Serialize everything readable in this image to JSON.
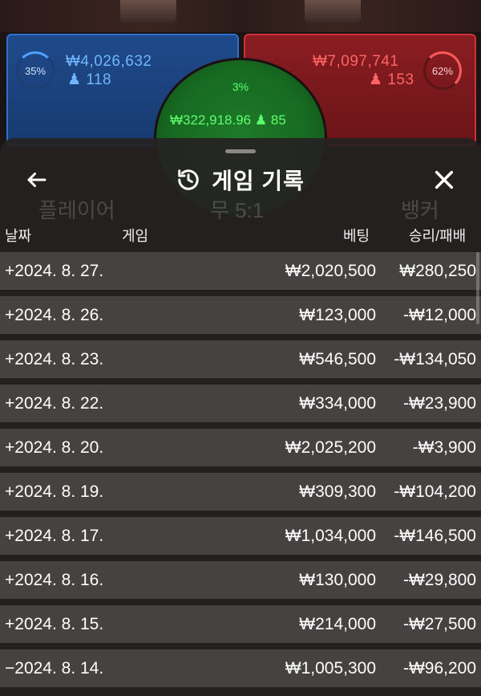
{
  "background": {
    "player": {
      "percent": "35%",
      "amount": "₩4,026,632",
      "players": "118"
    },
    "banker": {
      "percent": "62%",
      "amount": "₩7,097,741",
      "players": "153"
    },
    "tie": {
      "percent": "3%",
      "amount": "₩322,918.96",
      "players": "85"
    },
    "ghost_labels": {
      "player": "플레이어",
      "tie": "무 5:1",
      "banker": "뱅커"
    }
  },
  "header": {
    "title": "게임 기록",
    "back_icon": "arrow-left-icon",
    "history_icon": "history-icon",
    "close_icon": "close-icon"
  },
  "columns": {
    "date": "날짜",
    "game": "게임",
    "bet": "베팅",
    "result": "승리/패배"
  },
  "rows": [
    {
      "date": "+2024. 8. 27.",
      "bet": "₩2,020,500",
      "result": "₩280,250"
    },
    {
      "date": "+2024. 8. 26.",
      "bet": "₩123,000",
      "result": "-₩12,000"
    },
    {
      "date": "+2024. 8. 23.",
      "bet": "₩546,500",
      "result": "-₩134,050"
    },
    {
      "date": "+2024. 8. 22.",
      "bet": "₩334,000",
      "result": "-₩23,900"
    },
    {
      "date": "+2024. 8. 20.",
      "bet": "₩2,025,200",
      "result": "-₩3,900"
    },
    {
      "date": "+2024. 8. 19.",
      "bet": "₩309,300",
      "result": "-₩104,200"
    },
    {
      "date": "+2024. 8. 17.",
      "bet": "₩1,034,000",
      "result": "-₩146,500"
    },
    {
      "date": "+2024. 8. 16.",
      "bet": "₩130,000",
      "result": "-₩29,800"
    },
    {
      "date": "+2024. 8. 15.",
      "bet": "₩214,000",
      "result": "-₩27,500"
    },
    {
      "date": "−2024. 8. 14.",
      "bet": "₩1,005,300",
      "result": "-₩96,200"
    }
  ],
  "colors": {
    "player": "#2e6fd0",
    "banker": "#d03036",
    "tie": "#1e7a2a"
  }
}
